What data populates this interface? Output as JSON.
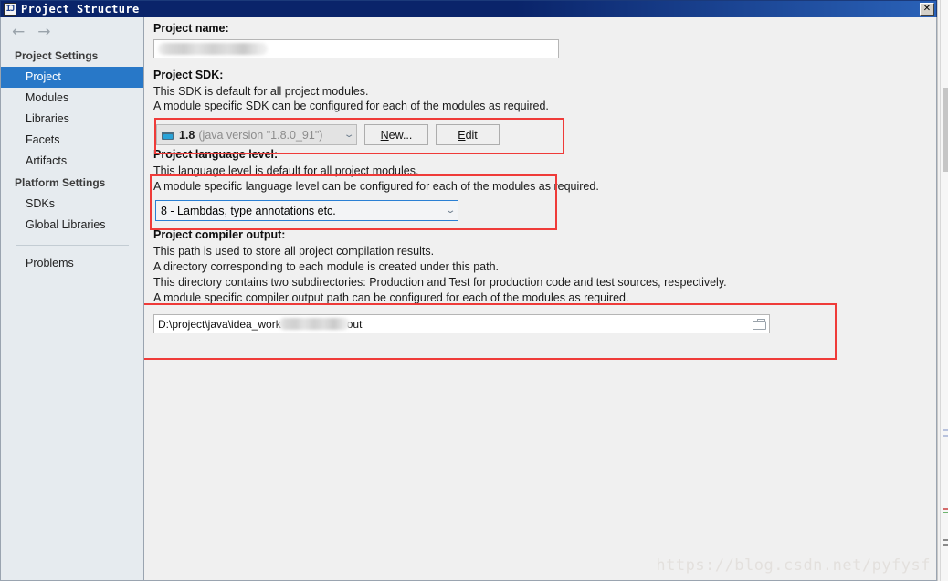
{
  "window": {
    "title": "Project Structure",
    "icon": "IJ",
    "close_label": "✕"
  },
  "sidebar": {
    "nav_back": "←",
    "nav_forward": "→",
    "groups": [
      {
        "title": "Project Settings",
        "items": [
          {
            "label": "Project",
            "selected": true
          },
          {
            "label": "Modules",
            "selected": false
          },
          {
            "label": "Libraries",
            "selected": false
          },
          {
            "label": "Facets",
            "selected": false
          },
          {
            "label": "Artifacts",
            "selected": false
          }
        ]
      },
      {
        "title": "Platform Settings",
        "items": [
          {
            "label": "SDKs",
            "selected": false
          },
          {
            "label": "Global Libraries",
            "selected": false
          }
        ]
      }
    ],
    "problems": "Problems"
  },
  "project_name": {
    "label": "Project name:",
    "value": "",
    "value_redacted": true
  },
  "project_sdk": {
    "label": "Project SDK:",
    "desc_line1": "This SDK is default for all project modules.",
    "desc_line2": "A module specific SDK can be configured for each of the modules as required.",
    "selected_version": "1.8",
    "selected_detail": "(java version \"1.8.0_91\")",
    "new_button": "New...",
    "new_button_mnemonic": "N",
    "edit_button": "Edit",
    "edit_button_mnemonic": "E"
  },
  "language_level": {
    "label": "Project language level:",
    "desc_line1": "This language level is default for all project modules.",
    "desc_line2": "A module specific language level can be configured for each of the modules as required.",
    "selected": "8 - Lambdas, type annotations etc."
  },
  "compiler_output": {
    "label": "Project compiler output:",
    "desc_line1": "This path is used to store all project compilation results.",
    "desc_line2": "A directory corresponding to each module is created under this path.",
    "desc_line3": "This directory contains two subdirectories: Production and Test for production code and test sources, respectively.",
    "desc_line4": "A module specific compiler output path can be configured for each of the modules as required.",
    "path_prefix": "D:\\project\\java\\idea_work",
    "path_suffix": "out",
    "path_redacted_middle": true
  },
  "annotations": {
    "boxes": [
      {
        "name": "sdk-row-highlight"
      },
      {
        "name": "language-level-highlight"
      },
      {
        "name": "compiler-output-highlight"
      }
    ],
    "color": "#ef3b39"
  },
  "watermark": "https://blog.csdn.net/pyfysf"
}
